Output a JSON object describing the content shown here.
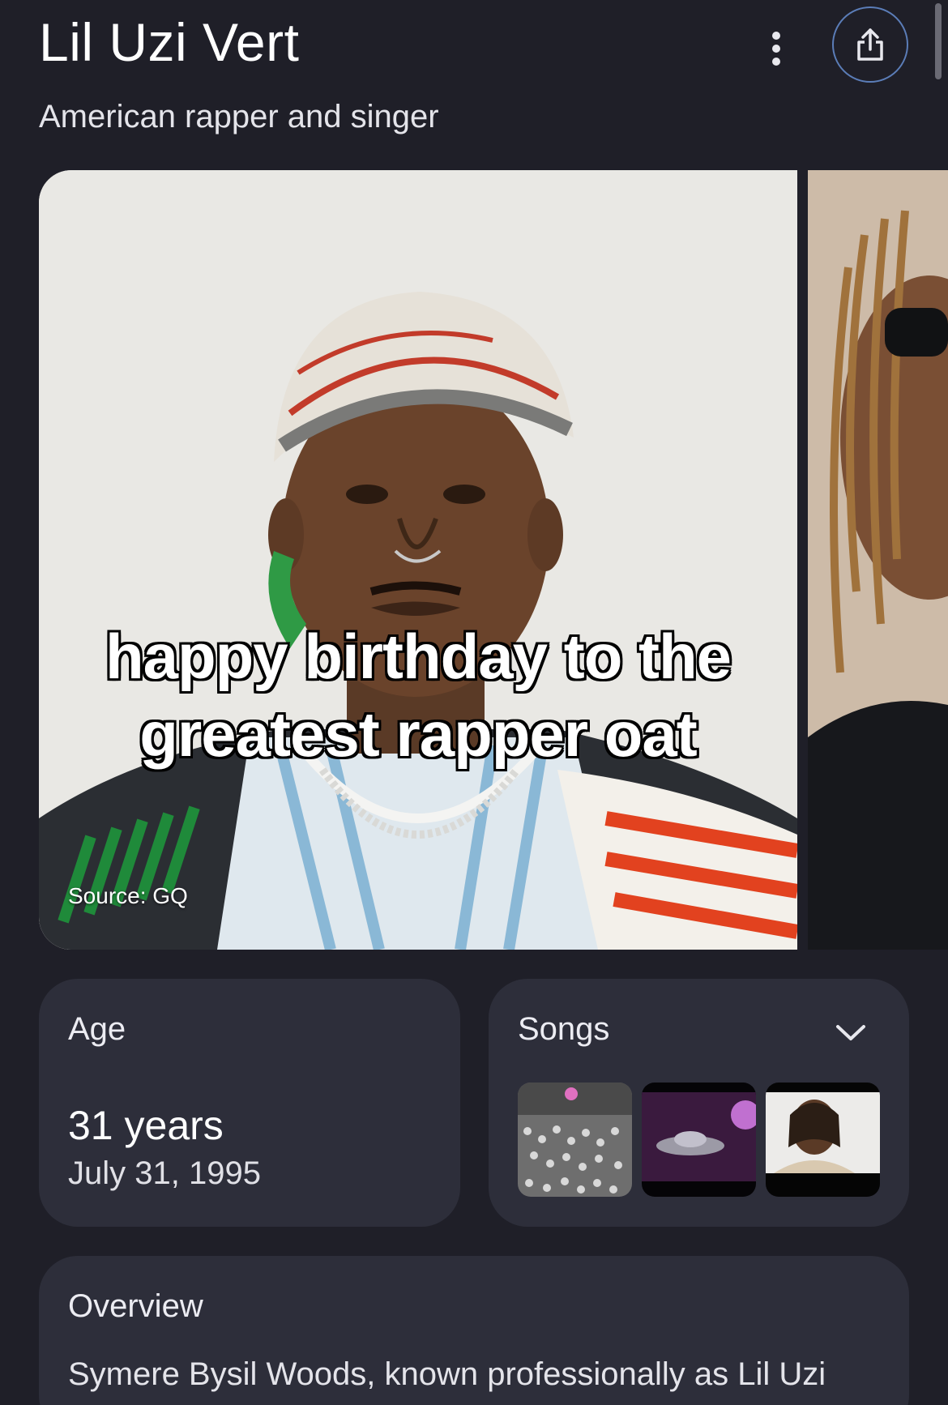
{
  "header": {
    "title": "Lil Uzi Vert",
    "subtitle": "American rapper and singer",
    "more_icon": "more-vert-icon",
    "share_icon": "share-icon"
  },
  "carousel": {
    "caption_line1": "happy birthday to the",
    "caption_line2": "greatest rapper oat",
    "source": "Source: GQ"
  },
  "age_card": {
    "label": "Age",
    "value": "31 years",
    "date": "July 31, 1995"
  },
  "songs_card": {
    "label": "Songs",
    "expand_icon": "chevron-down-icon",
    "thumbnails": 3
  },
  "overview": {
    "label": "Overview",
    "text": "Symere Bysil Woods, known professionally as Lil Uzi"
  },
  "colors": {
    "background": "#1f1f28",
    "card": "#2d2e3a",
    "share_ring": "#5b7db8"
  }
}
